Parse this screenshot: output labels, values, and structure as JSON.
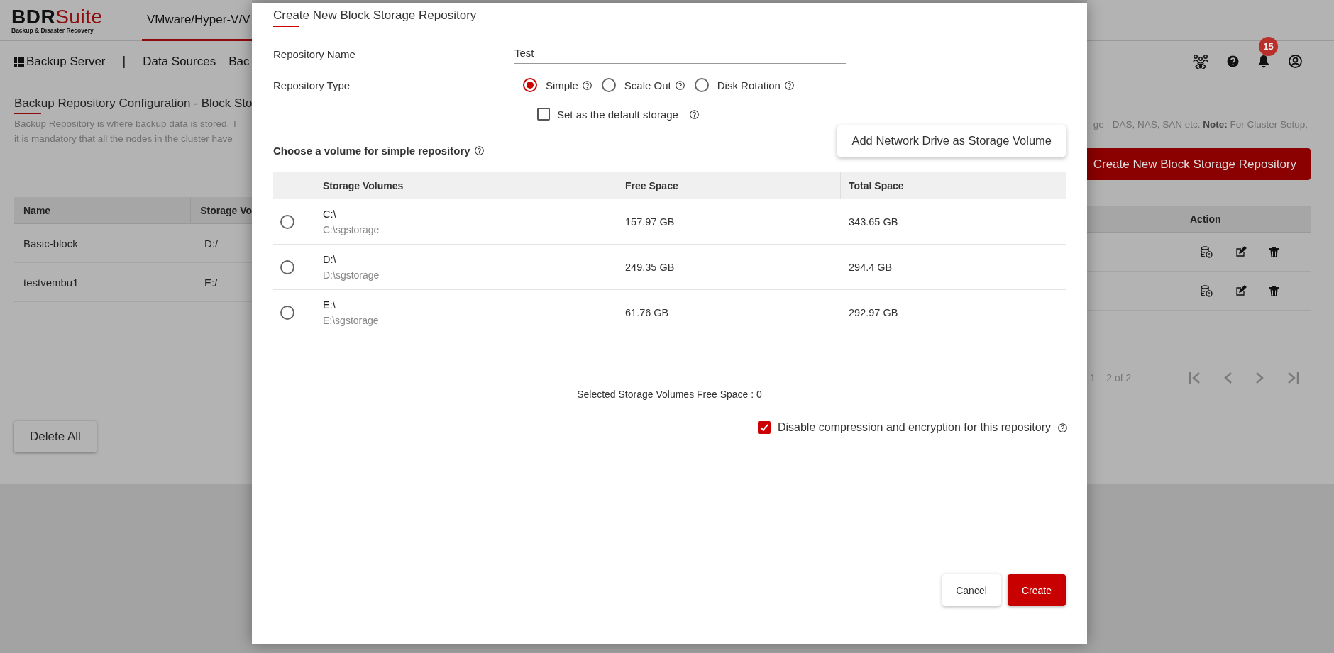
{
  "header": {
    "logo_main": "BDR",
    "logo_accent": "Suite",
    "logo_tagline": "Backup & Disaster Recovery",
    "product_tab": {
      "label": "VMware/Hyper-V/V",
      "selected": true
    }
  },
  "nav": {
    "items": [
      {
        "label": "Backup Server",
        "kind": "app-menu"
      },
      {
        "label": "|",
        "kind": "separator"
      },
      {
        "label": "Data Sources",
        "kind": "link"
      },
      {
        "label": "Bac",
        "kind": "link"
      }
    ],
    "notification_count": "15"
  },
  "page": {
    "title": "Backup Repository Configuration - Block Sto",
    "description_left": [
      "Backup Repository is where backup data is stored. T",
      "it is mandatory that all the nodes in the cluster have"
    ],
    "description_right": "ge - DAS, NAS, SAN etc. **Note:** For Cluster Setup,",
    "create_button": "Create New Block Storage Repository",
    "table": {
      "columns": [
        "Name",
        "Storage Vo",
        "Action"
      ],
      "rows": [
        {
          "name": "Basic-block",
          "storage": "D:/"
        },
        {
          "name": "testvembu1",
          "storage": "E:/"
        }
      ]
    },
    "pagination": "1 – 2 of 2",
    "delete_all_button": "Delete All"
  },
  "dialog": {
    "title": "Create New Block Storage Repository",
    "name_label": "Repository Name",
    "name_value": "Test",
    "type_label": "Repository Type",
    "types": [
      {
        "label": "Simple",
        "selected": true
      },
      {
        "label": "Scale Out",
        "selected": false
      },
      {
        "label": "Disk Rotation",
        "selected": false
      }
    ],
    "default_storage": {
      "label": "Set as the default storage",
      "checked": false
    },
    "volume_heading": "Choose a volume for simple repository",
    "add_network_button": "Add Network Drive as Storage Volume",
    "volume_table": {
      "columns": [
        "Storage Volumes",
        "Free Space",
        "Total Space"
      ],
      "rows": [
        {
          "drive": "C:\\",
          "path": "C:\\sgstorage",
          "free": "157.97 GB",
          "total": "343.65 GB",
          "selected": false
        },
        {
          "drive": "D:\\",
          "path": "D:\\sgstorage",
          "free": "249.35 GB",
          "total": "294.4 GB",
          "selected": false
        },
        {
          "drive": "E:\\",
          "path": "E:\\sgstorage",
          "free": "61.76 GB",
          "total": "292.97 GB",
          "selected": false
        }
      ]
    },
    "free_space_summary": "Selected Storage Volumes Free Space : 0",
    "disable_compression": {
      "label": "Disable compression and encryption for this repository",
      "checked": true
    },
    "buttons": [
      {
        "label": "Cancel",
        "kind": "secondary"
      },
      {
        "label": "Create",
        "kind": "primary"
      }
    ]
  }
}
